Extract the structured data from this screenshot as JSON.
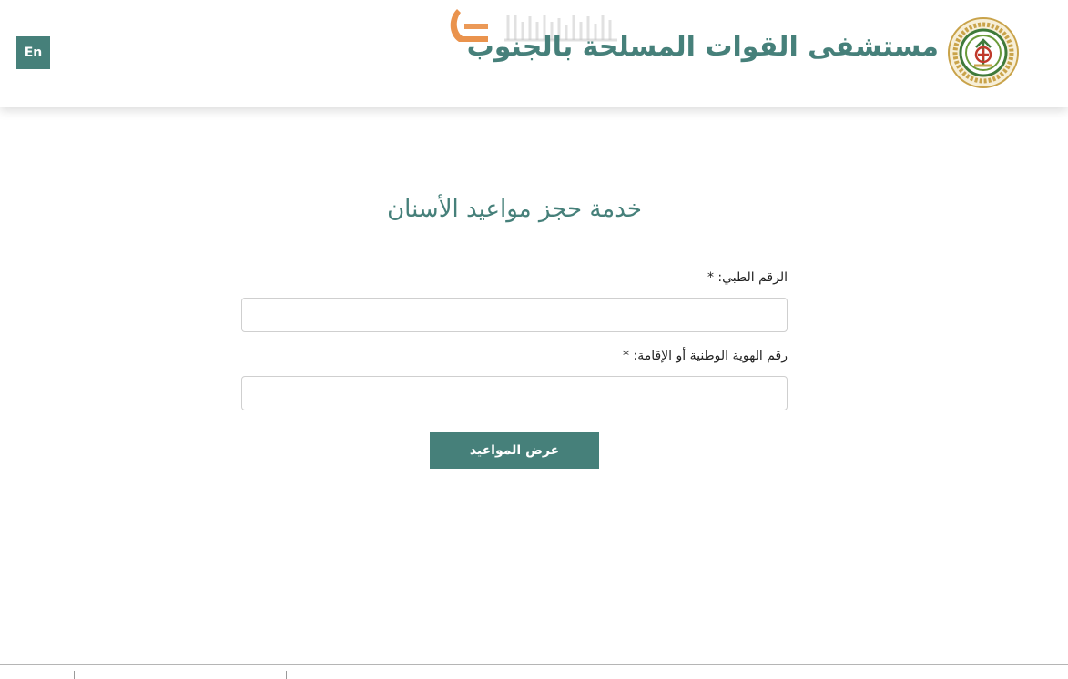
{
  "header": {
    "hospital_name": "مستشفى القوات المسلحة بالجنوب",
    "language_button": "En",
    "logo_icon": "hospital-emblem-icon",
    "watermark_icon": "site-watermark-icon"
  },
  "form": {
    "title": "خدمة حجز مواعيد الأسنان",
    "medical_number_label": "الرقم الطبي: *",
    "medical_number_value": "",
    "national_id_label": "رقم الهوية الوطنية أو الإقامة: *",
    "national_id_value": "",
    "submit_label": "عرض المواعيد"
  },
  "colors": {
    "brand": "#46807a",
    "text": "#222222",
    "input_border": "#cfcfcf",
    "logo_gold": "#c9a34a",
    "logo_green": "#3f7a3a",
    "logo_red": "#c0392b",
    "watermark_orange": "#e8873a"
  }
}
